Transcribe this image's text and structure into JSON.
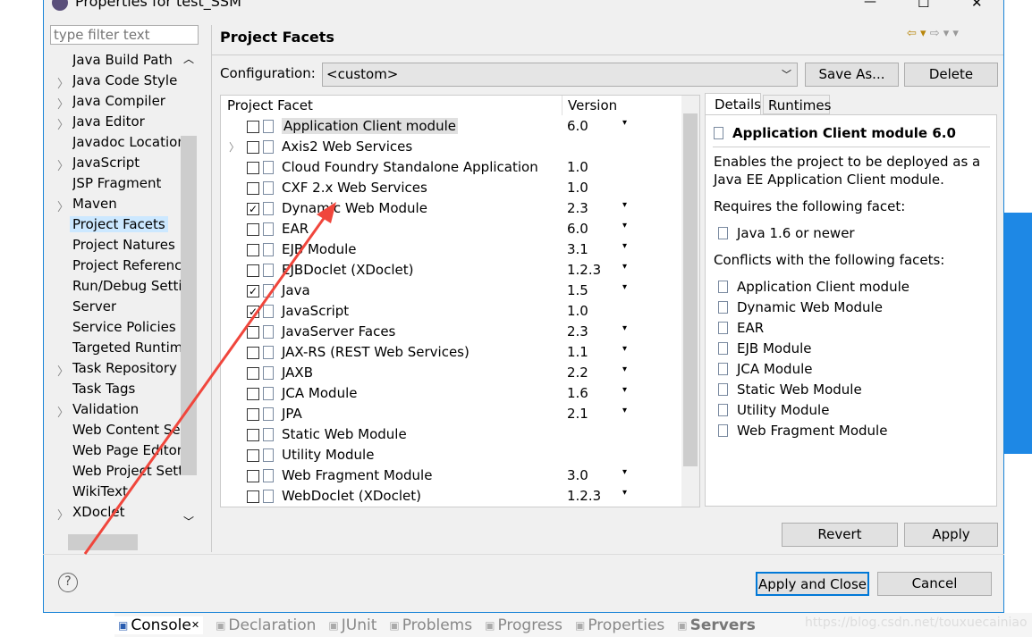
{
  "window": {
    "title": "Properties for test_SSM",
    "minimize": "—",
    "maximize": "☐",
    "close": "✕"
  },
  "filter": {
    "placeholder": "type filter text"
  },
  "tree": [
    {
      "label": "Java Build Path",
      "chevron": false
    },
    {
      "label": "Java Code Style",
      "chevron": true
    },
    {
      "label": "Java Compiler",
      "chevron": true
    },
    {
      "label": "Java Editor",
      "chevron": true
    },
    {
      "label": "Javadoc Location",
      "chevron": false
    },
    {
      "label": "JavaScript",
      "chevron": true
    },
    {
      "label": "JSP Fragment",
      "chevron": false
    },
    {
      "label": "Maven",
      "chevron": true
    },
    {
      "label": "Project Facets",
      "chevron": false,
      "selected": true
    },
    {
      "label": "Project Natures",
      "chevron": false
    },
    {
      "label": "Project References",
      "chevron": false
    },
    {
      "label": "Run/Debug Settings",
      "chevron": false
    },
    {
      "label": "Server",
      "chevron": false
    },
    {
      "label": "Service Policies",
      "chevron": false
    },
    {
      "label": "Targeted Runtimes",
      "chevron": false
    },
    {
      "label": "Task Repository",
      "chevron": true
    },
    {
      "label": "Task Tags",
      "chevron": false
    },
    {
      "label": "Validation",
      "chevron": true
    },
    {
      "label": "Web Content Settings",
      "chevron": false
    },
    {
      "label": "Web Page Editor",
      "chevron": false
    },
    {
      "label": "Web Project Settings",
      "chevron": false
    },
    {
      "label": "WikiText",
      "chevron": false
    },
    {
      "label": "XDoclet",
      "chevron": true
    }
  ],
  "page": {
    "title": "Project Facets",
    "config_label": "Configuration:",
    "config_value": "<custom>",
    "save_as": "Save As...",
    "delete": "Delete"
  },
  "table": {
    "col_facet": "Project Facet",
    "col_version": "Version",
    "rows": [
      {
        "name": "Application Client module",
        "version": "6.0",
        "checked": false,
        "dd": true,
        "highlight": true
      },
      {
        "name": "Axis2 Web Services",
        "version": "",
        "checked": false,
        "dd": false,
        "expand": true
      },
      {
        "name": "Cloud Foundry Standalone Application",
        "version": "1.0",
        "checked": false,
        "dd": false
      },
      {
        "name": "CXF 2.x Web Services",
        "version": "1.0",
        "checked": false,
        "dd": false
      },
      {
        "name": "Dynamic Web Module",
        "version": "2.3",
        "checked": true,
        "dd": true
      },
      {
        "name": "EAR",
        "version": "6.0",
        "checked": false,
        "dd": true
      },
      {
        "name": "EJB Module",
        "version": "3.1",
        "checked": false,
        "dd": true
      },
      {
        "name": "EJBDoclet (XDoclet)",
        "version": "1.2.3",
        "checked": false,
        "dd": true
      },
      {
        "name": "Java",
        "version": "1.5",
        "checked": true,
        "dd": true
      },
      {
        "name": "JavaScript",
        "version": "1.0",
        "checked": true,
        "dd": false
      },
      {
        "name": "JavaServer Faces",
        "version": "2.3",
        "checked": false,
        "dd": true
      },
      {
        "name": "JAX-RS (REST Web Services)",
        "version": "1.1",
        "checked": false,
        "dd": true
      },
      {
        "name": "JAXB",
        "version": "2.2",
        "checked": false,
        "dd": true
      },
      {
        "name": "JCA Module",
        "version": "1.6",
        "checked": false,
        "dd": true
      },
      {
        "name": "JPA",
        "version": "2.1",
        "checked": false,
        "dd": true
      },
      {
        "name": "Static Web Module",
        "version": "",
        "checked": false,
        "dd": false
      },
      {
        "name": "Utility Module",
        "version": "",
        "checked": false,
        "dd": false
      },
      {
        "name": "Web Fragment Module",
        "version": "3.0",
        "checked": false,
        "dd": true
      },
      {
        "name": "WebDoclet (XDoclet)",
        "version": "1.2.3",
        "checked": false,
        "dd": true
      }
    ]
  },
  "details": {
    "tab_details": "Details",
    "tab_runtimes": "Runtimes",
    "title": "Application Client module 6.0",
    "desc1": "Enables the project to be deployed as a",
    "desc2": "Java EE Application Client module.",
    "requires": "Requires the following facet:",
    "req_item": "Java 1.6 or newer",
    "conflicts": "Conflicts with the following facets:",
    "conflict_items": [
      "Application Client module",
      "Dynamic Web Module",
      "EAR",
      "EJB Module",
      "JCA Module",
      "Static Web Module",
      "Utility Module",
      "Web Fragment Module"
    ]
  },
  "buttons": {
    "revert": "Revert",
    "apply": "Apply",
    "apply_close": "Apply and Close",
    "cancel": "Cancel",
    "help": "?"
  },
  "bottom_tabs": [
    "Console",
    "Declaration",
    "JUnit",
    "Problems",
    "Progress",
    "Properties",
    "Servers"
  ],
  "watermark": "https://blog.csdn.net/touxuecainiao",
  "colors": {
    "accent": "#1883d7",
    "selection": "#cce8ff",
    "arrow": "#f0463c"
  }
}
